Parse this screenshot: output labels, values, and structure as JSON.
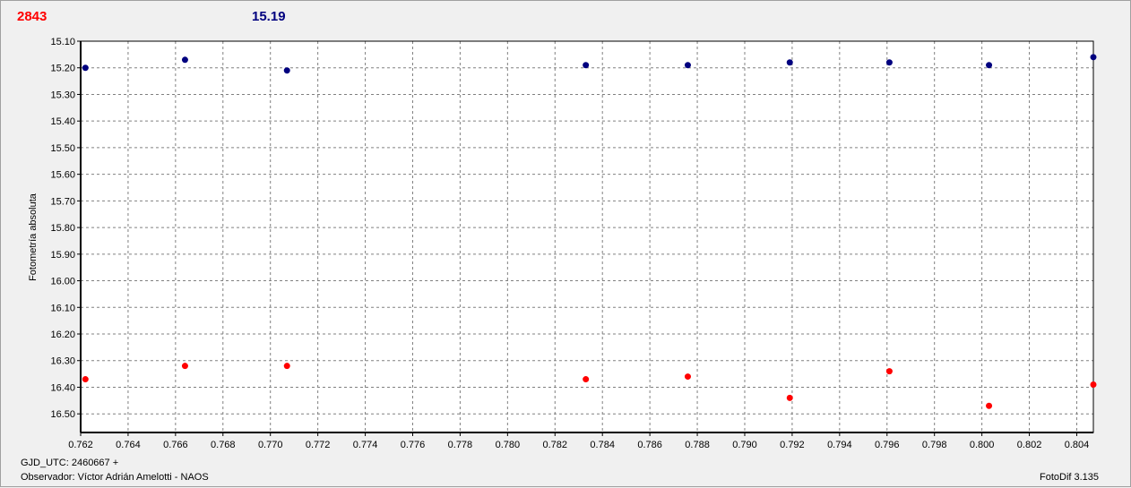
{
  "header": {
    "series_a_value": "2843",
    "series_b_value": "15.19"
  },
  "footer": {
    "gjd_label": "GJD_UTC: 2460667 +",
    "observer": "Observador: Víctor Adrián Amelotti - NAOS",
    "software": "FotoDif 3.135"
  },
  "colors": {
    "series_a": "#ff0000",
    "series_b": "#00007f",
    "grid": "#808080",
    "plot_bg": "#ffffff"
  },
  "chart_data": {
    "type": "scatter",
    "ylabel": "Fotometría absoluta",
    "xlabel": "",
    "xlim": [
      0.762,
      0.8047
    ],
    "ylim": [
      16.57,
      15.1
    ],
    "y_inverted": true,
    "grid": true,
    "x_ticks": [
      "0.762",
      "0.764",
      "0.766",
      "0.768",
      "0.770",
      "0.772",
      "0.774",
      "0.776",
      "0.778",
      "0.780",
      "0.782",
      "0.784",
      "0.786",
      "0.788",
      "0.790",
      "0.792",
      "0.794",
      "0.796",
      "0.798",
      "0.800",
      "0.802",
      "0.804"
    ],
    "y_ticks": [
      "15.10",
      "15.20",
      "15.30",
      "15.40",
      "15.50",
      "15.60",
      "15.70",
      "15.80",
      "15.90",
      "16.00",
      "16.10",
      "16.20",
      "16.30",
      "16.40",
      "16.50"
    ],
    "series": [
      {
        "x": [
          0.7622,
          0.7664,
          0.7707,
          0.7833,
          0.7876,
          0.7919,
          0.7961,
          0.8003,
          0.8047
        ],
        "y": [
          16.37,
          16.32,
          16.32,
          16.37,
          16.36,
          16.44,
          16.34,
          16.47,
          16.39
        ]
      },
      {
        "x": [
          0.7622,
          0.7664,
          0.7707,
          0.7833,
          0.7876,
          0.7919,
          0.7961,
          0.8003,
          0.8047
        ],
        "y": [
          15.2,
          15.17,
          15.21,
          15.19,
          15.19,
          15.18,
          15.18,
          15.19,
          15.16
        ]
      }
    ]
  }
}
